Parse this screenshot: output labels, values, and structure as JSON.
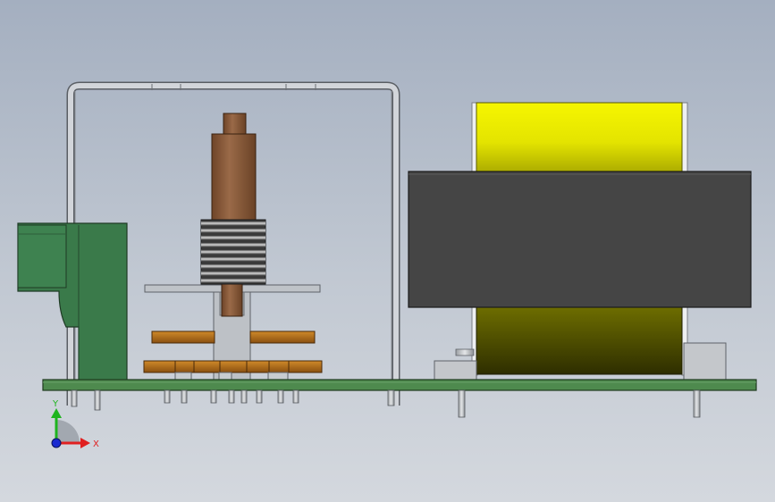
{
  "axes": {
    "x_label": "X",
    "y_label": "Y",
    "x_color": "#e02020",
    "y_color": "#1eb41e",
    "z_color": "#1a2ad0"
  },
  "colors": {
    "pcb": "#4e8a4e",
    "green_block": "#3a7a4a",
    "coil_yellow": "#ecec00",
    "coil_dark": "#4a4a00",
    "transformer_core": "#454545",
    "bracket": "#c8ccd2",
    "brown_part": "#8a5a3a",
    "terminal_orange": "#b0701a",
    "pin_gray": "#c6c9cc"
  },
  "components": [
    {
      "name": "pcb-board"
    },
    {
      "name": "green-terminal-block"
    },
    {
      "name": "metal-frame-bracket"
    },
    {
      "name": "brown-cylinder-part"
    },
    {
      "name": "ribbed-spring-coil"
    },
    {
      "name": "rotary-switch-wafers"
    },
    {
      "name": "transformer"
    }
  ]
}
